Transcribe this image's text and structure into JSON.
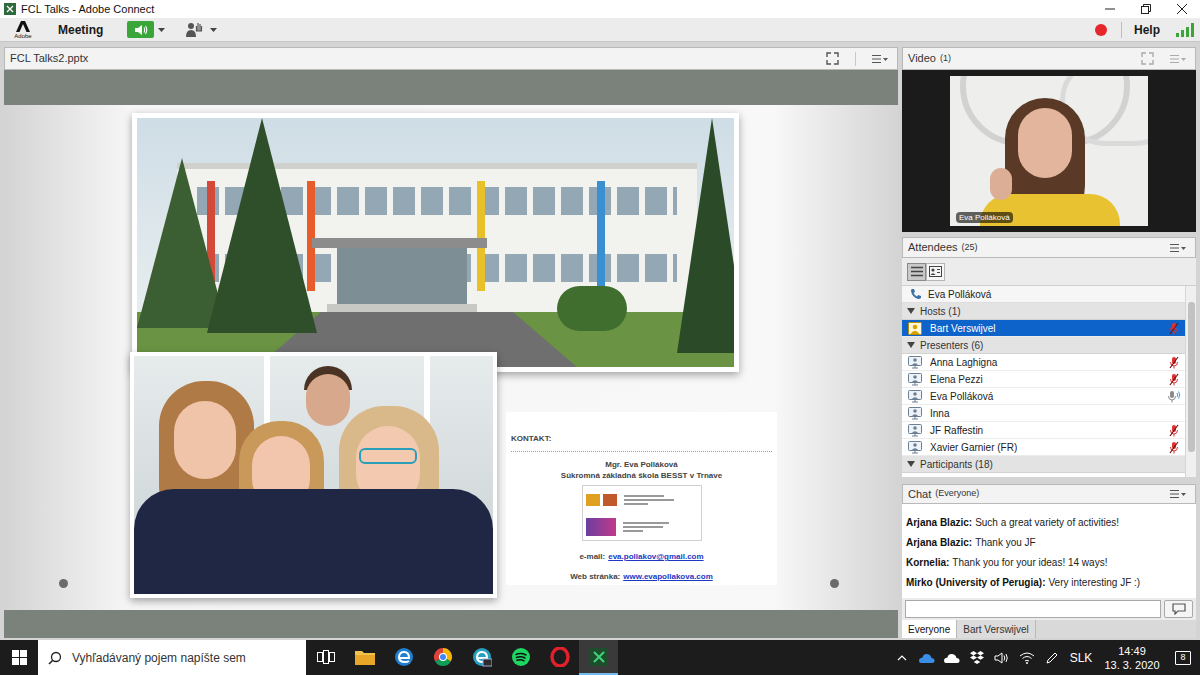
{
  "window": {
    "title": "FCL Talks - Adobe Connect"
  },
  "menubar": {
    "logo_text": "Adobe",
    "items": [
      {
        "label": "Meeting"
      }
    ],
    "speaker": {
      "on": true
    },
    "help": "Help",
    "recording": true
  },
  "share_pod": {
    "title": "FCL Talks2.pptx",
    "slide": {
      "contact": {
        "heading": "KONTAKT:",
        "name": "Mgr. Eva Polláková",
        "school": "Súkromná základná škola BESST v Trnave",
        "email_label": "e-mail:",
        "email": "eva.pollakov@gmail.com",
        "web_label": "Web stránka:",
        "web": "www.evapollakova.com"
      }
    }
  },
  "video_pod": {
    "title": "Video",
    "count": "(1)",
    "speaker_name": "Eva Polláková"
  },
  "attendees_pod": {
    "title": "Attendees",
    "count": "(25)",
    "view_modes": [
      {
        "kind": "list",
        "selected": true
      },
      {
        "kind": "detail",
        "selected": false
      }
    ],
    "dial_in": {
      "name": "Eva Polláková"
    },
    "groups": [
      {
        "label": "Hosts (1)",
        "kind": "host",
        "expanded": true,
        "members": [
          {
            "name": "Bart Verswijvel",
            "selected": true,
            "audio": "muted"
          }
        ]
      },
      {
        "label": "Presenters (6)",
        "kind": "presenter",
        "expanded": true,
        "members": [
          {
            "name": "Anna Laghigna",
            "selected": false,
            "audio": "muted"
          },
          {
            "name": "Elena Pezzi",
            "selected": false,
            "audio": "muted"
          },
          {
            "name": "Eva Polláková",
            "selected": false,
            "audio": "speaking"
          },
          {
            "name": "Inna",
            "selected": false,
            "audio": "none"
          },
          {
            "name": "JF Raffestin",
            "selected": false,
            "audio": "muted"
          },
          {
            "name": "Xavier Garnier (FR)",
            "selected": false,
            "audio": "muted"
          }
        ]
      },
      {
        "label": "Participants (18)",
        "kind": "participant",
        "expanded": true,
        "members": []
      }
    ]
  },
  "chat_pod": {
    "title": "Chat",
    "count": "(Everyone)",
    "messages": [
      {
        "author": "Arjana Blazic:",
        "text": "Such a great variety of activities!"
      },
      {
        "author": "Arjana Blazic:",
        "text": "Thank you JF"
      },
      {
        "author": "Kornelia:",
        "text": "Thank you for your ideas! 14 ways!"
      },
      {
        "author": "Mirko (University of Perugia):",
        "text": "Very interesting JF :)"
      }
    ],
    "tabs": [
      {
        "label": "Everyone",
        "selected": true
      },
      {
        "label": "Bart Verswijvel",
        "selected": false
      }
    ]
  },
  "taskbar": {
    "search": {
      "placeholder": "Vyhľadávaný pojem napíšte sem"
    },
    "apps": [
      {
        "kind": "taskview",
        "active": false
      },
      {
        "kind": "explorer",
        "active": false
      },
      {
        "kind": "edge",
        "active": false
      },
      {
        "kind": "chrome",
        "active": false
      },
      {
        "kind": "edgebeta",
        "active": false
      },
      {
        "kind": "spotify",
        "active": false
      },
      {
        "kind": "opera",
        "active": false
      },
      {
        "kind": "connect",
        "active": true
      }
    ],
    "language": "SLK",
    "time": "14:49",
    "date": "13. 3. 2020",
    "notifications": "8"
  }
}
